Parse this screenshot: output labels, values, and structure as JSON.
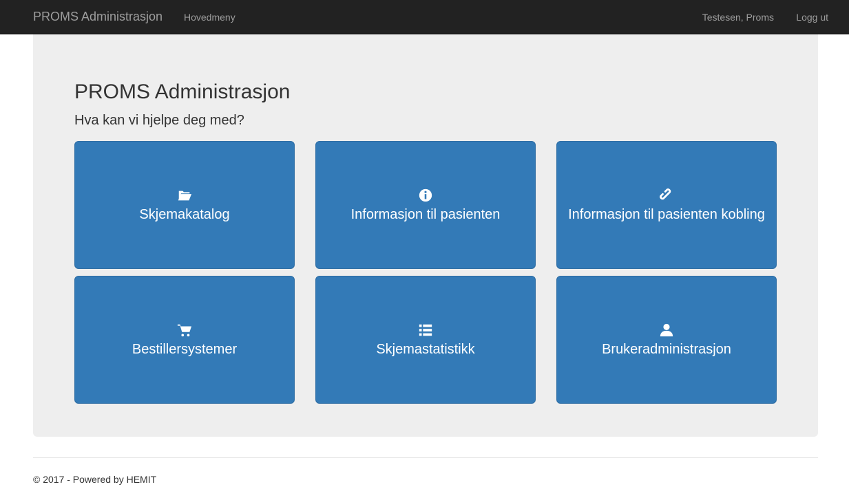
{
  "navbar": {
    "brand": "PROMS Administrasjon",
    "main_menu": "Hovedmeny",
    "user": "Testesen, Proms",
    "logout": "Logg ut"
  },
  "main": {
    "title": "PROMS Administrasjon",
    "subtitle": "Hva kan vi hjelpe deg med?",
    "tiles": [
      {
        "label": "Skjemakatalog",
        "icon": "folder-open-icon"
      },
      {
        "label": "Informasjon til pasienten",
        "icon": "info-icon"
      },
      {
        "label": "Informasjon til pasienten kobling",
        "icon": "link-icon"
      },
      {
        "label": "Bestillersystemer",
        "icon": "cart-icon"
      },
      {
        "label": "Skjemastatistikk",
        "icon": "list-icon"
      },
      {
        "label": "Brukeradministrasjon",
        "icon": "user-icon"
      }
    ]
  },
  "footer": {
    "text": "© 2017 - Powered by HEMIT"
  },
  "colors": {
    "navbar": "#222222",
    "navbar_text": "#9d9d9d",
    "jumbotron": "#eeeeee",
    "tile": "#337ab7",
    "tile_border": "#2e6da4"
  }
}
